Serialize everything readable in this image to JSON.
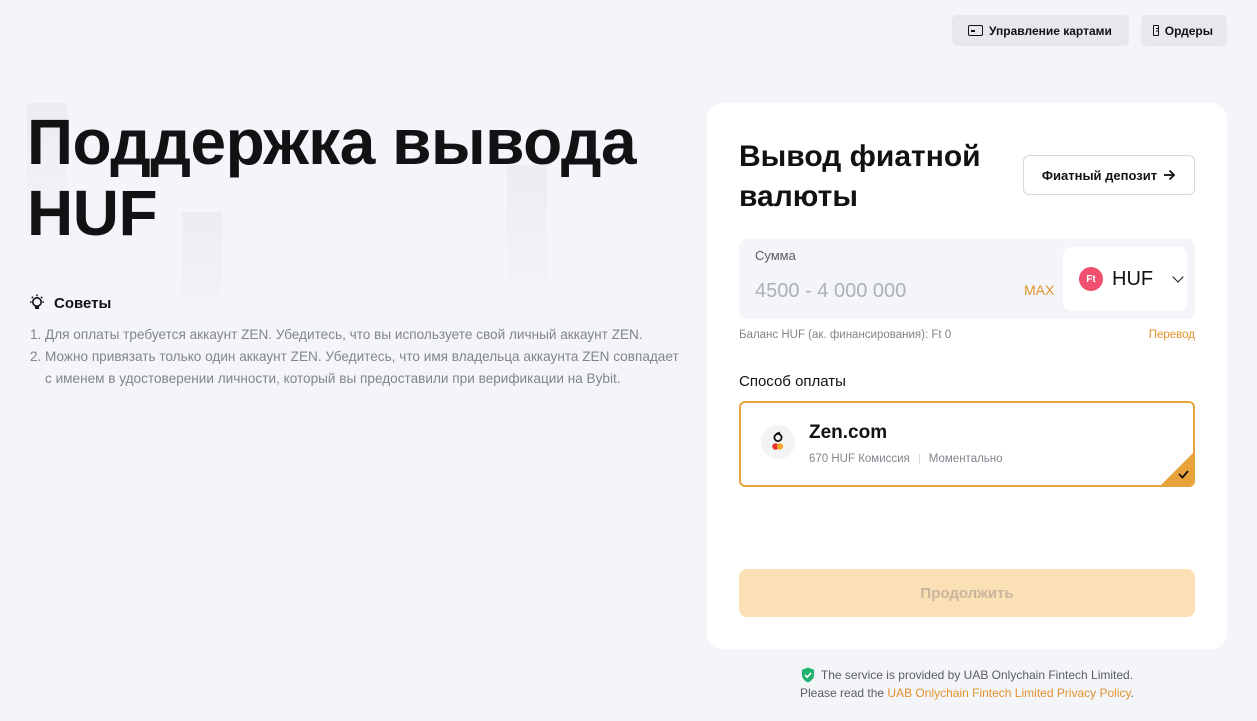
{
  "header": {
    "cards_button": "Управление картами",
    "orders_button": "Ордеры"
  },
  "hero": {
    "title_line1": "Поддержка вывода",
    "title_line2": "HUF"
  },
  "tips": {
    "title": "Советы",
    "items": [
      {
        "num": "1.",
        "text": "Для оплаты требуется аккаунт ZEN. Убедитесь, что вы используете свой личный аккаунт ZEN."
      },
      {
        "num": "2.",
        "text": "Можно привязать только один аккаунт ZEN. Убедитесь, что имя владельца аккаунта ZEN совпадает с именем в удостоверении личности, который вы предоставили при верификации на Bybit."
      }
    ]
  },
  "form": {
    "title": "Вывод фиатной валюты",
    "deposit_button": "Фиатный депозит",
    "amount_label": "Сумма",
    "amount_placeholder": "4500 - 4 000 000",
    "max_label": "MAX",
    "currency_badge": "Ft",
    "currency_code": "HUF",
    "balance_text": "Баланс HUF (ак. финансирования): Ft 0",
    "transfer_link": "Перевод",
    "method_label": "Способ оплаты",
    "method": {
      "name": "Zen.com",
      "fee": "670 HUF Комиссия",
      "speed": "Моментально"
    },
    "continue_button": "Продолжить"
  },
  "footer": {
    "line1": "The service is provided by UAB Onlychain Fintech Limited.",
    "line2_prefix": "Please read the",
    "link": "UAB Onlychain Fintech Limited Privacy Policy",
    "line2_suffix": "."
  },
  "colors": {
    "accent": "#e2922e",
    "selected_border": "#e8a33a",
    "continue_disabled_bg": "#fbdfb5",
    "currency_badge": "#f0506e",
    "shield": "#20b26c"
  },
  "icons": [
    "card-icon",
    "document-icon",
    "lightbulb-icon",
    "arrow-right-icon",
    "chevron-down-icon",
    "zen-logo-icon",
    "checkmark-icon",
    "shield-check-icon"
  ]
}
